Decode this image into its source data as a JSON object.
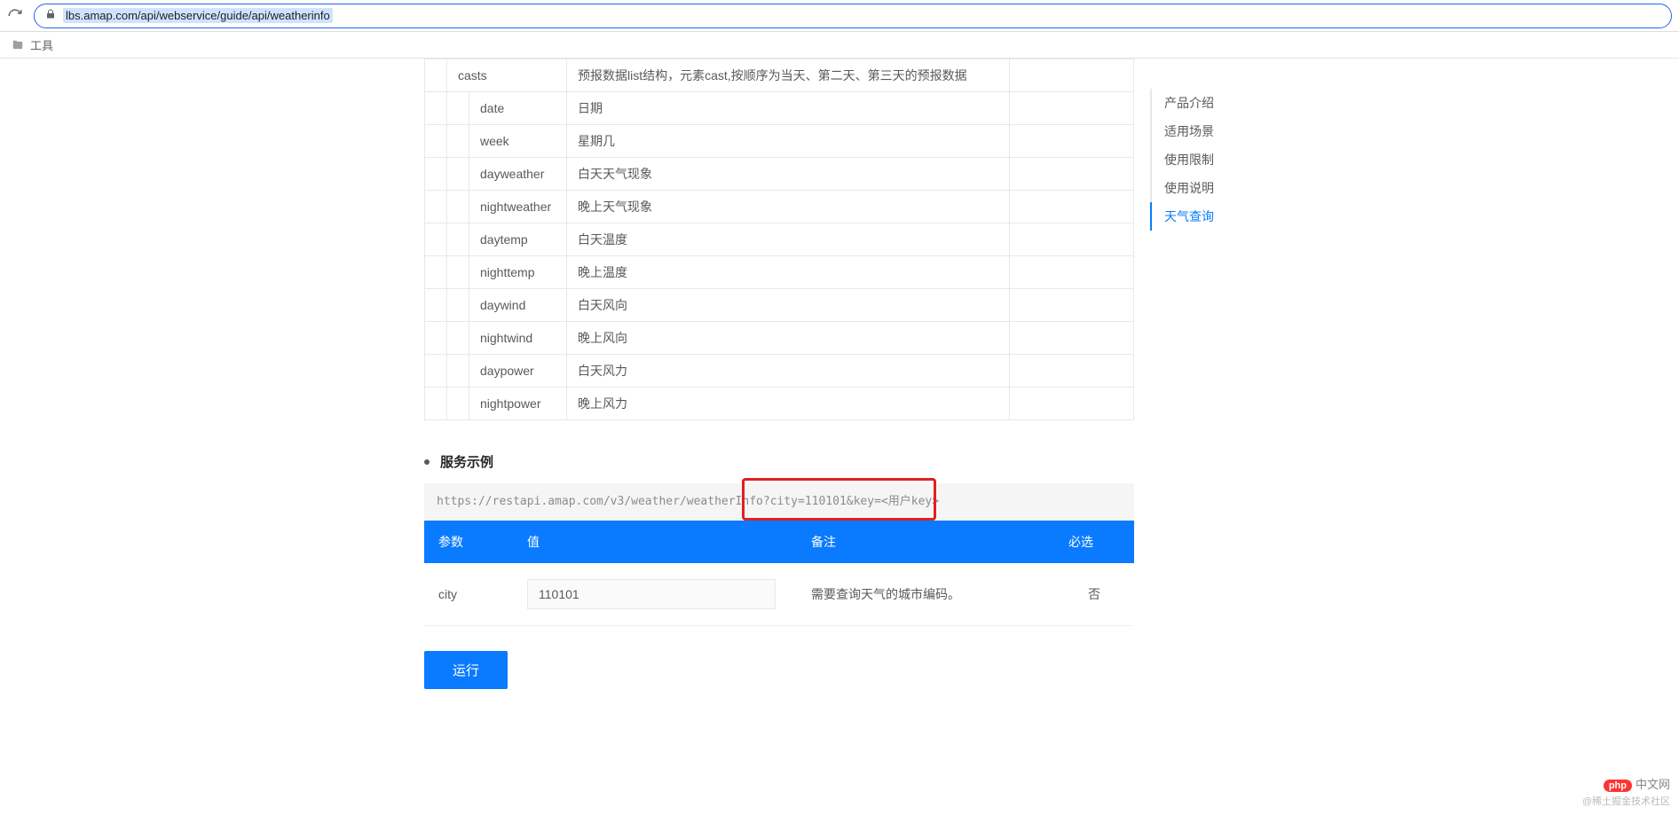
{
  "browser": {
    "url": "lbs.amap.com/api/webservice/guide/api/weatherinfo",
    "bookmark_folder": "工具"
  },
  "resp_fields": [
    {
      "indent": 1,
      "name": "casts",
      "desc": "预报数据list结构，元素cast,按顺序为当天、第二天、第三天的预报数据"
    },
    {
      "indent": 2,
      "name": "date",
      "desc": "日期"
    },
    {
      "indent": 2,
      "name": "week",
      "desc": "星期几"
    },
    {
      "indent": 2,
      "name": "dayweather",
      "desc": "白天天气现象"
    },
    {
      "indent": 2,
      "name": "nightweather",
      "desc": "晚上天气现象"
    },
    {
      "indent": 2,
      "name": "daytemp",
      "desc": "白天温度"
    },
    {
      "indent": 2,
      "name": "nighttemp",
      "desc": "晚上温度"
    },
    {
      "indent": 2,
      "name": "daywind",
      "desc": "白天风向"
    },
    {
      "indent": 2,
      "name": "nightwind",
      "desc": "晚上风向"
    },
    {
      "indent": 2,
      "name": "daypower",
      "desc": "白天风力"
    },
    {
      "indent": 2,
      "name": "nightpower",
      "desc": "晚上风力"
    }
  ],
  "example": {
    "heading": "服务示例",
    "url_scheme": "https:",
    "url_rest": "//restapi.amap.com/v3/weather/weatherInfo?city=110101&key=<用户key>"
  },
  "params_table": {
    "headers": {
      "param": "参数",
      "value": "值",
      "note": "备注",
      "required": "必选"
    },
    "rows": [
      {
        "param": "city",
        "value": "110101",
        "note": "需要查询天气的城市编码。",
        "required": "否"
      }
    ]
  },
  "run_label": "运行",
  "toc": [
    {
      "label": "产品介绍",
      "active": false
    },
    {
      "label": "适用场景",
      "active": false
    },
    {
      "label": "使用限制",
      "active": false
    },
    {
      "label": "使用说明",
      "active": false
    },
    {
      "label": "天气查询",
      "active": true
    }
  ],
  "watermark": {
    "pill": "php",
    "main": "中文网",
    "sub": "@稀土掘金技术社区"
  }
}
